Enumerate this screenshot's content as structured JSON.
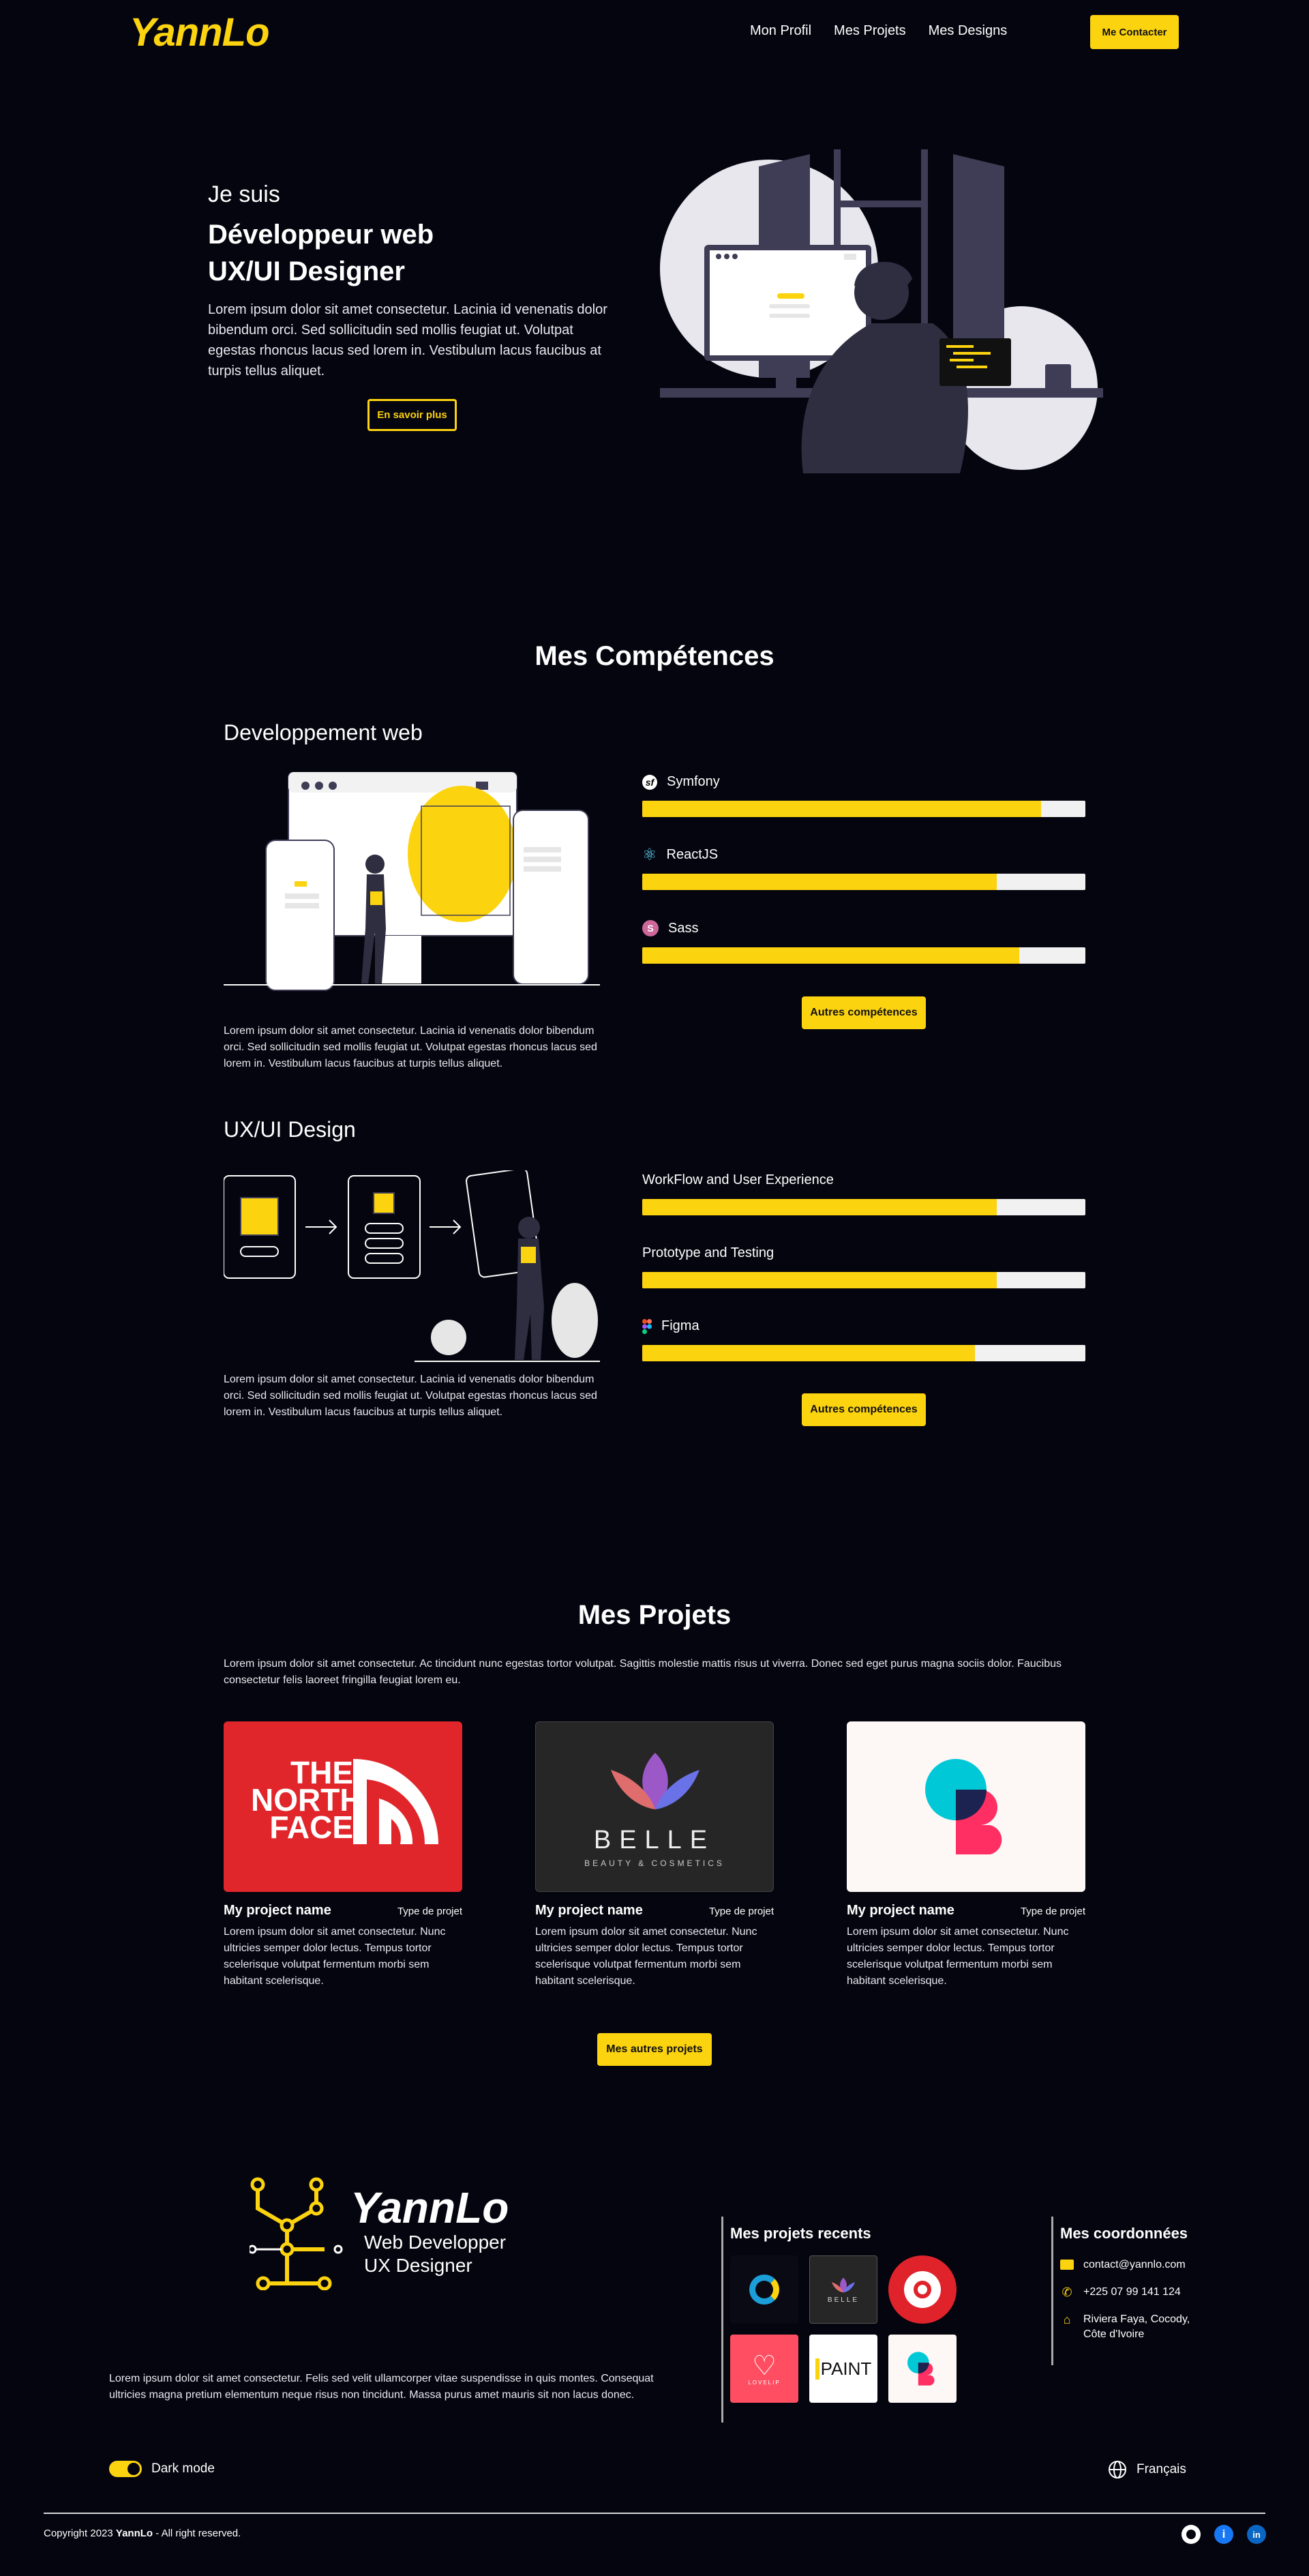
{
  "brand": {
    "logo": "YannLo",
    "accent": "#fcd30f",
    "background": "#05050f"
  },
  "nav": {
    "items": [
      "Mon Profil",
      "Mes Projets",
      "Mes Designs"
    ],
    "cta": "Me Contacter"
  },
  "hero": {
    "greeting": "Je suis",
    "title_line1": "Développeur web",
    "title_line2": "UX/UI Designer",
    "description": "Lorem ipsum dolor sit amet consectetur. Lacinia id venenatis dolor bibendum orci. Sed sollicitudin sed mollis feugiat ut. Volutpat egestas rhoncus lacus sed lorem in. Vestibulum lacus faucibus at turpis tellus aliquet.",
    "button": "En savoir plus"
  },
  "skills": {
    "title": "Mes Compétences",
    "web": {
      "title": "Developpement web",
      "description": "Lorem ipsum dolor sit amet consectetur. Lacinia id venenatis dolor bibendum orci. Sed sollicitudin sed mollis feugiat ut. Volutpat egestas rhoncus lacus sed lorem in. Vestibulum lacus faucibus at turpis tellus aliquet.",
      "items": [
        {
          "label": "Symfony",
          "icon": "symfony-icon",
          "level": 0.9
        },
        {
          "label": "ReactJS",
          "icon": "react-icon",
          "level": 0.8
        },
        {
          "label": "Sass",
          "icon": "sass-icon",
          "level": 0.85
        }
      ],
      "button": "Autres compétences"
    },
    "ux": {
      "title": "UX/UI Design",
      "description": "Lorem ipsum dolor sit amet consectetur. Lacinia id venenatis dolor bibendum orci. Sed sollicitudin sed mollis feugiat ut. Volutpat egestas rhoncus lacus sed lorem in. Vestibulum lacus faucibus at turpis tellus aliquet.",
      "items": [
        {
          "label": "WorkFlow and User Experience",
          "icon": "",
          "level": 0.8
        },
        {
          "label": "Prototype and Testing",
          "icon": "",
          "level": 0.8
        },
        {
          "label": "Figma",
          "icon": "figma-icon",
          "level": 0.75
        }
      ],
      "button": "Autres compétences"
    }
  },
  "projects": {
    "title": "Mes Projets",
    "intro": "Lorem ipsum dolor sit amet consectetur. Ac tincidunt nunc egestas tortor volutpat. Sagittis molestie mattis risus ut viverra. Donec sed eget purus magna sociis dolor. Faucibus consectetur felis laoreet fringilla feugiat lorem eu.",
    "cards": [
      {
        "name": "My project name",
        "type": "Type de projet",
        "description": "Lorem ipsum dolor sit amet consectetur. Nunc ultricies semper dolor lectus. Tempus tortor scelerisque volutpat fermentum morbi sem habitant scelerisque.",
        "logo_line1": "THE",
        "logo_line2": "NORTH",
        "logo_line3": "FACE"
      },
      {
        "name": "My project name",
        "type": "Type de projet",
        "description": "Lorem ipsum dolor sit amet consectetur. Nunc ultricies semper dolor lectus. Tempus tortor scelerisque volutpat fermentum morbi sem habitant scelerisque.",
        "logo_line1": "BELLE",
        "logo_line2": "BEAUTY & COSMETICS"
      },
      {
        "name": "My project name",
        "type": "Type de projet",
        "description": "Lorem ipsum dolor sit amet consectetur. Nunc ultricies semper dolor lectus. Tempus tortor scelerisque volutpat fermentum morbi sem habitant scelerisque."
      }
    ],
    "button": "Mes autres projets"
  },
  "footer": {
    "logo": "YannLo",
    "role_line1": "Web Developper",
    "role_line2": "UX Designer",
    "description": "Lorem ipsum dolor sit amet consectetur. Felis sed velit ullamcorper vitae suspendisse in quis montes. Consequat ultricies magna pretium elementum neque risus non tincidunt. Massa purus amet mauris sit non lacus donec.",
    "recent_title": "Mes projets recents",
    "recent_labels": {
      "belle": "BELLE",
      "lovelip": "LOVELIP",
      "paint": "PAINT"
    },
    "contact_title": "Mes coordonnées",
    "email": "contact@yannlo.com",
    "phone": "+225 07 99 141 124",
    "address_line1": "Riviera Faya, Cocody,",
    "address_line2": "Côte d'Ivoire",
    "dark_mode": "Dark mode",
    "language": "Français",
    "copyright_prefix": "Copyright 2023 ",
    "copyright_brand": "YannLo",
    "copyright_suffix": " - All right reserved."
  }
}
